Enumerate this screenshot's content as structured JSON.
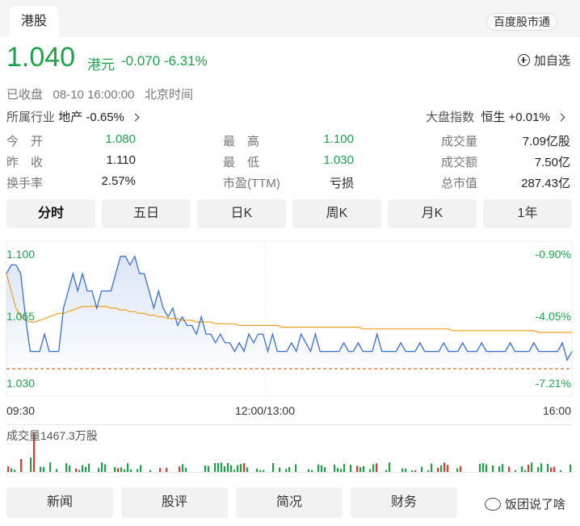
{
  "header": {
    "tab": "港股",
    "partner_button": "百度股市通"
  },
  "quote": {
    "price": "1.040",
    "unit": "港元",
    "change": "-0.070",
    "change_pct": "-6.31%",
    "add_watch": "加自选",
    "status": "已收盘",
    "datetime": "08-10 16:00:00",
    "timezone": "北京时间",
    "industry_label": "所属行业",
    "industry_value": "地产 -0.65%",
    "index_label": "大盘指数",
    "index_value": "恒生 +0.01%"
  },
  "stats": {
    "open_label": "今　开",
    "open": "1.080",
    "prev_label": "昨　收",
    "prev": "1.110",
    "turnover_label": "换手率",
    "turnover": "2.57%",
    "high_label": "最　高",
    "high": "1.100",
    "low_label": "最　低",
    "low": "1.030",
    "pe_label": "市盈(TTM)",
    "pe": "亏损",
    "volume_label": "成交量",
    "volume": "7.09亿股",
    "amount_label": "成交额",
    "amount": "7.50亿",
    "mktcap_label": "总市值",
    "mktcap": "287.43亿"
  },
  "period_tabs": [
    "分时",
    "五日",
    "日K",
    "周K",
    "月K",
    "1年"
  ],
  "chart_data": {
    "type": "line",
    "y_left_ticks": [
      "1.100",
      "1.065",
      "1.030"
    ],
    "y_right_ticks": [
      "-0.90%",
      "-4.05%",
      "-7.21%"
    ],
    "x_ticks": [
      "09:30",
      "12:00/13:00",
      "16:00"
    ],
    "ylim": [
      1.03,
      1.1
    ],
    "prev_close": 1.11,
    "series": [
      {
        "color": "#3b6fd8",
        "values": [
          1.085,
          1.09,
          1.09,
          1.085,
          1.06,
          1.04,
          1.04,
          1.04,
          1.05,
          1.04,
          1.04,
          1.04,
          1.065,
          1.075,
          1.085,
          1.075,
          1.085,
          1.075,
          1.075,
          1.065,
          1.075,
          1.075,
          1.075,
          1.085,
          1.095,
          1.095,
          1.09,
          1.095,
          1.085,
          1.085,
          1.075,
          1.065,
          1.075,
          1.065,
          1.06,
          1.065,
          1.055,
          1.06,
          1.055,
          1.055,
          1.05,
          1.06,
          1.05,
          1.05,
          1.045,
          1.05,
          1.045,
          1.045,
          1.04,
          1.045,
          1.04,
          1.05,
          1.045,
          1.05,
          1.05,
          1.04,
          1.05,
          1.04,
          1.04,
          1.04,
          1.045,
          1.04,
          1.05,
          1.045,
          1.04,
          1.05,
          1.04,
          1.04,
          1.04,
          1.04,
          1.04,
          1.045,
          1.04,
          1.04,
          1.045,
          1.04,
          1.04,
          1.04,
          1.05,
          1.04,
          1.04,
          1.04,
          1.04,
          1.045,
          1.04,
          1.04,
          1.04,
          1.045,
          1.04,
          1.04,
          1.04,
          1.04,
          1.045,
          1.04,
          1.04,
          1.04,
          1.045,
          1.04,
          1.04,
          1.04,
          1.045,
          1.04,
          1.04,
          1.04,
          1.04,
          1.04,
          1.045,
          1.04,
          1.04,
          1.04,
          1.04,
          1.045,
          1.04,
          1.04,
          1.04,
          1.04,
          1.04,
          1.045,
          1.035,
          1.04
        ]
      },
      {
        "color": "#f0a020",
        "values": [
          1.085,
          1.075,
          1.065,
          1.06,
          1.058,
          1.057,
          1.057,
          1.058,
          1.059,
          1.06,
          1.061,
          1.062,
          1.062,
          1.063,
          1.064,
          1.065,
          1.066,
          1.066,
          1.066,
          1.066,
          1.066,
          1.066,
          1.065,
          1.065,
          1.064,
          1.064,
          1.063,
          1.063,
          1.062,
          1.062,
          1.061,
          1.061,
          1.06,
          1.06,
          1.059,
          1.059,
          1.059,
          1.058,
          1.058,
          1.058,
          1.057,
          1.057,
          1.057,
          1.057,
          1.056,
          1.056,
          1.056,
          1.056,
          1.056,
          1.055,
          1.055,
          1.055,
          1.055,
          1.055,
          1.055,
          1.055,
          1.055,
          1.055,
          1.054,
          1.054,
          1.054,
          1.054,
          1.054,
          1.054,
          1.054,
          1.054,
          1.054,
          1.054,
          1.054,
          1.054,
          1.054,
          1.054,
          1.054,
          1.054,
          1.054,
          1.053,
          1.053,
          1.053,
          1.053,
          1.053,
          1.053,
          1.053,
          1.053,
          1.053,
          1.053,
          1.053,
          1.053,
          1.053,
          1.053,
          1.053,
          1.053,
          1.053,
          1.053,
          1.053,
          1.052,
          1.052,
          1.052,
          1.052,
          1.052,
          1.052,
          1.052,
          1.052,
          1.052,
          1.052,
          1.052,
          1.052,
          1.052,
          1.052,
          1.052,
          1.052,
          1.052,
          1.052,
          1.051,
          1.051,
          1.051,
          1.051,
          1.051,
          1.051,
          1.051,
          1.051
        ]
      }
    ]
  },
  "volume_title": "成交量1467.3万股",
  "bottom_tabs": [
    "新闻",
    "股评",
    "简况",
    "财务"
  ],
  "watermark": "饭团说了啥",
  "colors": {
    "down": "#1fa14a",
    "line": "#3b6fd8",
    "avg": "#f0a020",
    "prev_close_line": "#e06b2a"
  }
}
